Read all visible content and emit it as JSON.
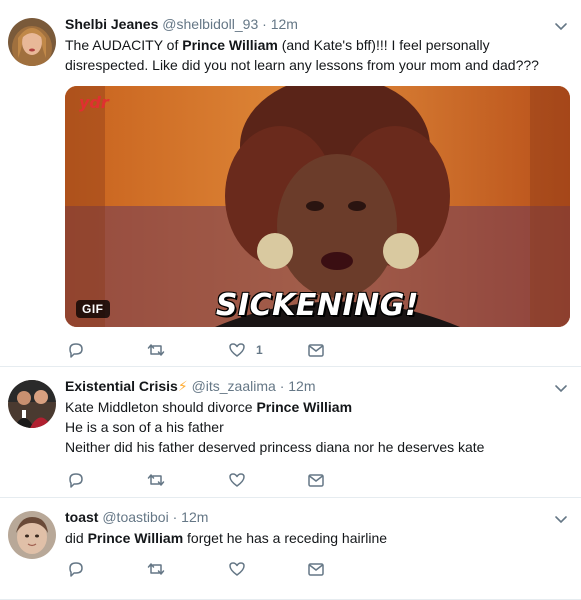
{
  "tweets": [
    {
      "name": "Shelbi Jeanes",
      "handle": "@shelbidoll_93",
      "time": "12m",
      "text_parts": [
        "The AUDACITY of ",
        "Prince William",
        " (and Kate's bff)!!! I feel personally disrespected. Like did you not learn any lessons from your mom and dad???"
      ],
      "media": {
        "type": "GIF",
        "badge": "GIF",
        "caption": "SICKENING!",
        "watermark": "ydr"
      },
      "actions": {
        "reply": "",
        "retweet": "",
        "like": "1"
      }
    },
    {
      "name": "Existential Crisis",
      "emoji": "⚡",
      "handle": "@its_zaalima",
      "time": "12m",
      "line1_parts": [
        "Kate Middleton should divorce ",
        "Prince William"
      ],
      "line2": "He is a son of a his father",
      "line3": "Neither did his father deserved princess diana nor he deserves kate",
      "actions": {
        "reply": "",
        "retweet": "",
        "like": ""
      }
    },
    {
      "name": "toast",
      "handle": "@toastiboi",
      "time": "12m",
      "text_parts": [
        "did ",
        "Prince William",
        " forget he has a receding hairline"
      ],
      "actions": {
        "reply": "",
        "retweet": "",
        "like": ""
      }
    }
  ],
  "separator": "·",
  "colors": {
    "text": "#14171a",
    "muted": "#657786",
    "border": "#e6ecf0",
    "icon": "#657786"
  }
}
